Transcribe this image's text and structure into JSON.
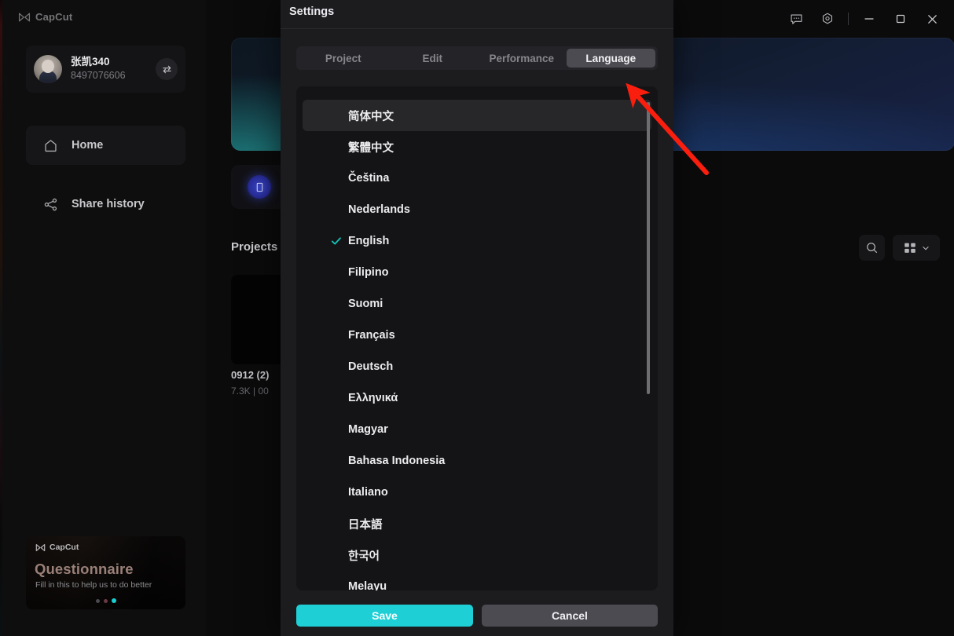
{
  "window": {
    "brand": "CapCut",
    "controls": [
      {
        "name": "feedback-icon",
        "label": "Feedback"
      },
      {
        "name": "settings-gear-icon",
        "label": "Settings"
      },
      {
        "name": "minimize-icon",
        "label": "Minimize"
      },
      {
        "name": "maximize-icon",
        "label": "Maximize"
      },
      {
        "name": "close-icon",
        "label": "Close"
      }
    ]
  },
  "sidebar": {
    "brand": "CapCut",
    "profile": {
      "name": "张凯340",
      "id": "8497076606",
      "switch_label": "Switch account"
    },
    "nav": [
      {
        "label": "Home",
        "icon": "home-icon",
        "active": true
      },
      {
        "label": "Share history",
        "icon": "share-icon",
        "active": false
      }
    ],
    "promo": {
      "brand": "CapCut",
      "title": "Questionnaire",
      "subtitle": "Fill in this to help us to do better",
      "dots": 3,
      "active_dot": 3
    }
  },
  "main": {
    "projects_label": "Projects",
    "project": {
      "title": "0912 (2)",
      "meta": "7.3K | 00"
    },
    "toolbar": {
      "search_label": "Search",
      "view_label": "View mode"
    }
  },
  "dialog": {
    "title": "Settings",
    "tabs": [
      {
        "label": "Project",
        "active": false
      },
      {
        "label": "Edit",
        "active": false
      },
      {
        "label": "Performance",
        "active": false
      },
      {
        "label": "Language",
        "active": true
      }
    ],
    "languages": [
      {
        "label": "简体中文",
        "selected": false,
        "hovered": true
      },
      {
        "label": "繁體中文",
        "selected": false,
        "hovered": false
      },
      {
        "label": "Čeština",
        "selected": false,
        "hovered": false
      },
      {
        "label": "Nederlands",
        "selected": false,
        "hovered": false
      },
      {
        "label": "English",
        "selected": true,
        "hovered": false
      },
      {
        "label": "Filipino",
        "selected": false,
        "hovered": false
      },
      {
        "label": "Suomi",
        "selected": false,
        "hovered": false
      },
      {
        "label": "Français",
        "selected": false,
        "hovered": false
      },
      {
        "label": "Deutsch",
        "selected": false,
        "hovered": false
      },
      {
        "label": "Ελληνικά",
        "selected": false,
        "hovered": false
      },
      {
        "label": "Magyar",
        "selected": false,
        "hovered": false
      },
      {
        "label": "Bahasa Indonesia",
        "selected": false,
        "hovered": false
      },
      {
        "label": "Italiano",
        "selected": false,
        "hovered": false
      },
      {
        "label": "日本語",
        "selected": false,
        "hovered": false
      },
      {
        "label": "한국어",
        "selected": false,
        "hovered": false
      },
      {
        "label": "Melayu",
        "selected": false,
        "hovered": false
      }
    ],
    "buttons": {
      "save": "Save",
      "cancel": "Cancel"
    }
  },
  "annotation": {
    "type": "arrow",
    "color": "#fa1e0e",
    "points_to": "Language"
  },
  "colors": {
    "accent": "#1ecfd5",
    "check": "#12c4bb",
    "dialog_bg": "#1c1c1f",
    "list_bg": "#141416",
    "tab_active": "#4b4b51",
    "annotation_red": "#fa1e0e"
  }
}
